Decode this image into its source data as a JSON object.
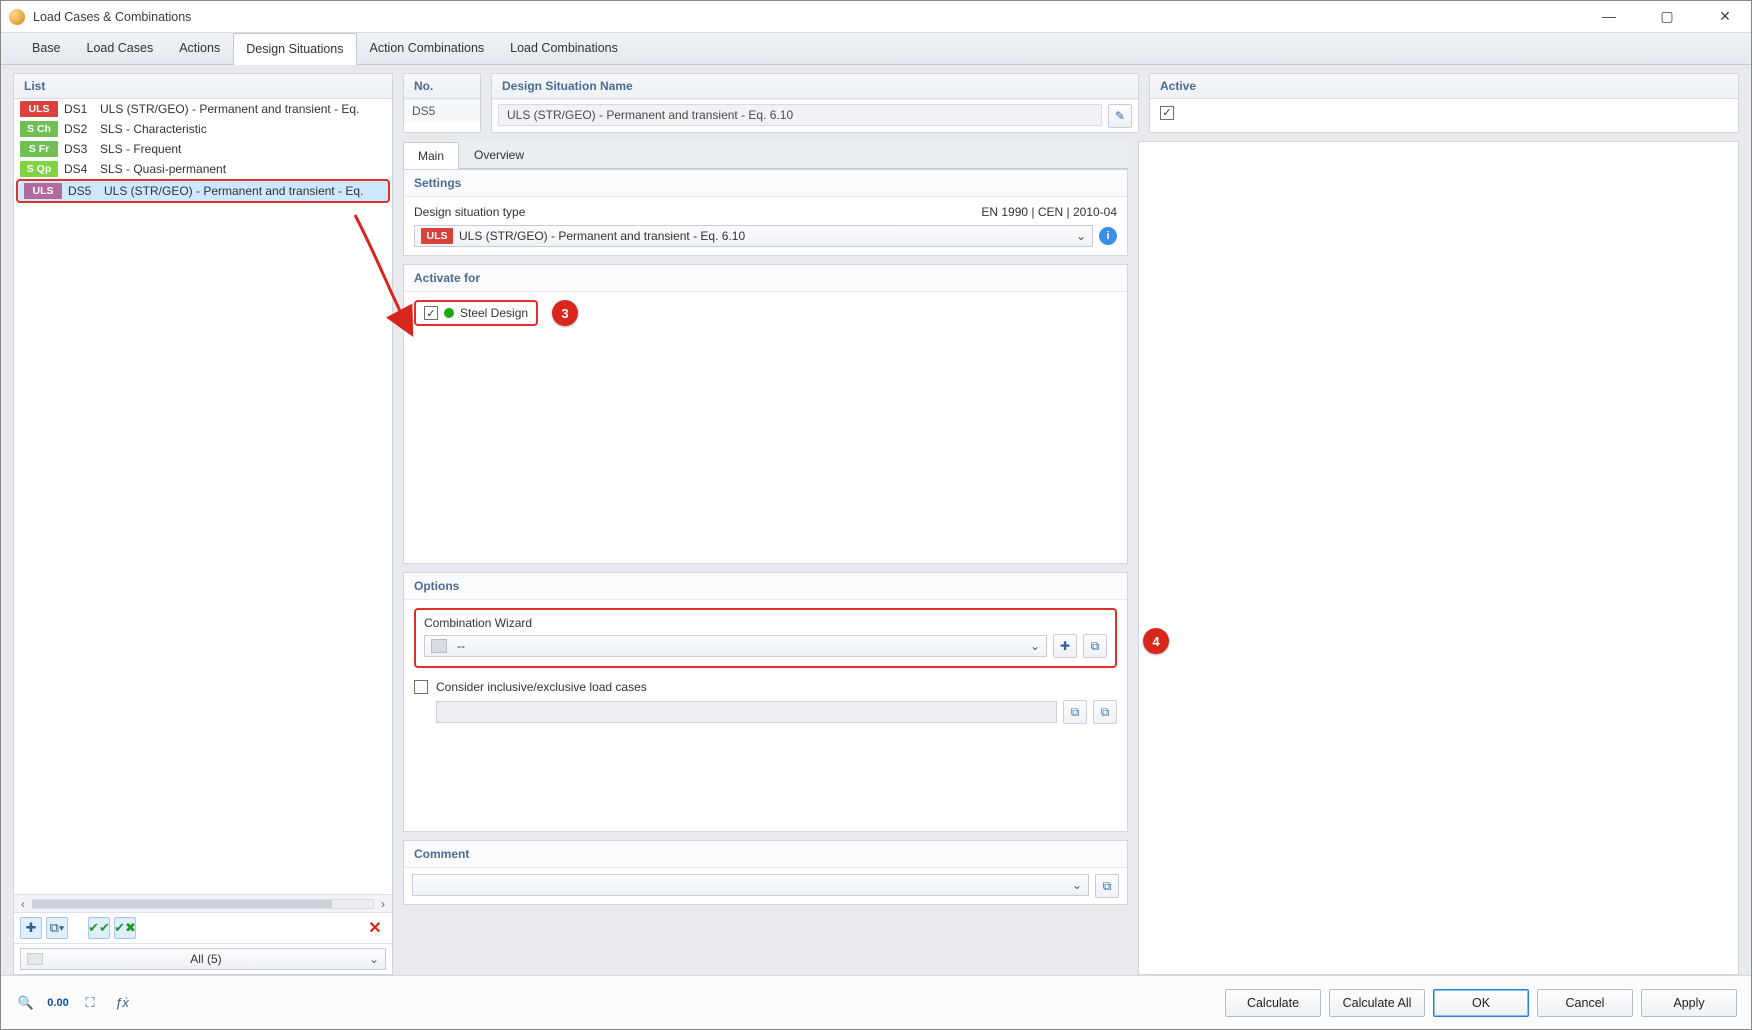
{
  "window": {
    "title": "Load Cases & Combinations"
  },
  "tabs": {
    "items": [
      "Base",
      "Load Cases",
      "Actions",
      "Design Situations",
      "Action Combinations",
      "Load Combinations"
    ],
    "active_index": 3
  },
  "list": {
    "header": "List",
    "items": [
      {
        "badge": "ULS",
        "badge_class": "uls",
        "num": "DS1",
        "text": "ULS (STR/GEO) - Permanent and transient - Eq."
      },
      {
        "badge": "S Ch",
        "badge_class": "sch",
        "num": "DS2",
        "text": "SLS - Characteristic"
      },
      {
        "badge": "S Fr",
        "badge_class": "sfr",
        "num": "DS3",
        "text": "SLS - Frequent"
      },
      {
        "badge": "S Qp",
        "badge_class": "sqp",
        "num": "DS4",
        "text": "SLS - Quasi-permanent"
      },
      {
        "badge": "ULS",
        "badge_class": "uls-sel",
        "num": "DS5",
        "text": "ULS (STR/GEO) - Permanent and transient - Eq.",
        "selected": true
      }
    ],
    "filter": "All (5)"
  },
  "header3": {
    "no_label": "No.",
    "no_value": "DS5",
    "name_label": "Design Situation Name",
    "name_value": "ULS (STR/GEO) - Permanent and transient - Eq. 6.10",
    "active_label": "Active"
  },
  "subtabs": {
    "items": [
      "Main",
      "Overview"
    ],
    "active_index": 0
  },
  "settings": {
    "header": "Settings",
    "type_label": "Design situation type",
    "type_right": "EN 1990 | CEN | 2010-04",
    "combo_badge": "ULS",
    "combo_text": "ULS (STR/GEO) - Permanent and transient - Eq. 6.10"
  },
  "activate": {
    "header": "Activate for",
    "label": "Steel Design",
    "checked": true,
    "callout": "3"
  },
  "options": {
    "header": "Options",
    "wizard_label": "Combination Wizard",
    "wizard_value": "--",
    "callout": "4",
    "consider_label": "Consider inclusive/exclusive load cases",
    "consider_checked": false
  },
  "comment": {
    "header": "Comment",
    "value": ""
  },
  "footer": {
    "calculate": "Calculate",
    "calculate_all": "Calculate All",
    "ok": "OK",
    "cancel": "Cancel",
    "apply": "Apply"
  }
}
